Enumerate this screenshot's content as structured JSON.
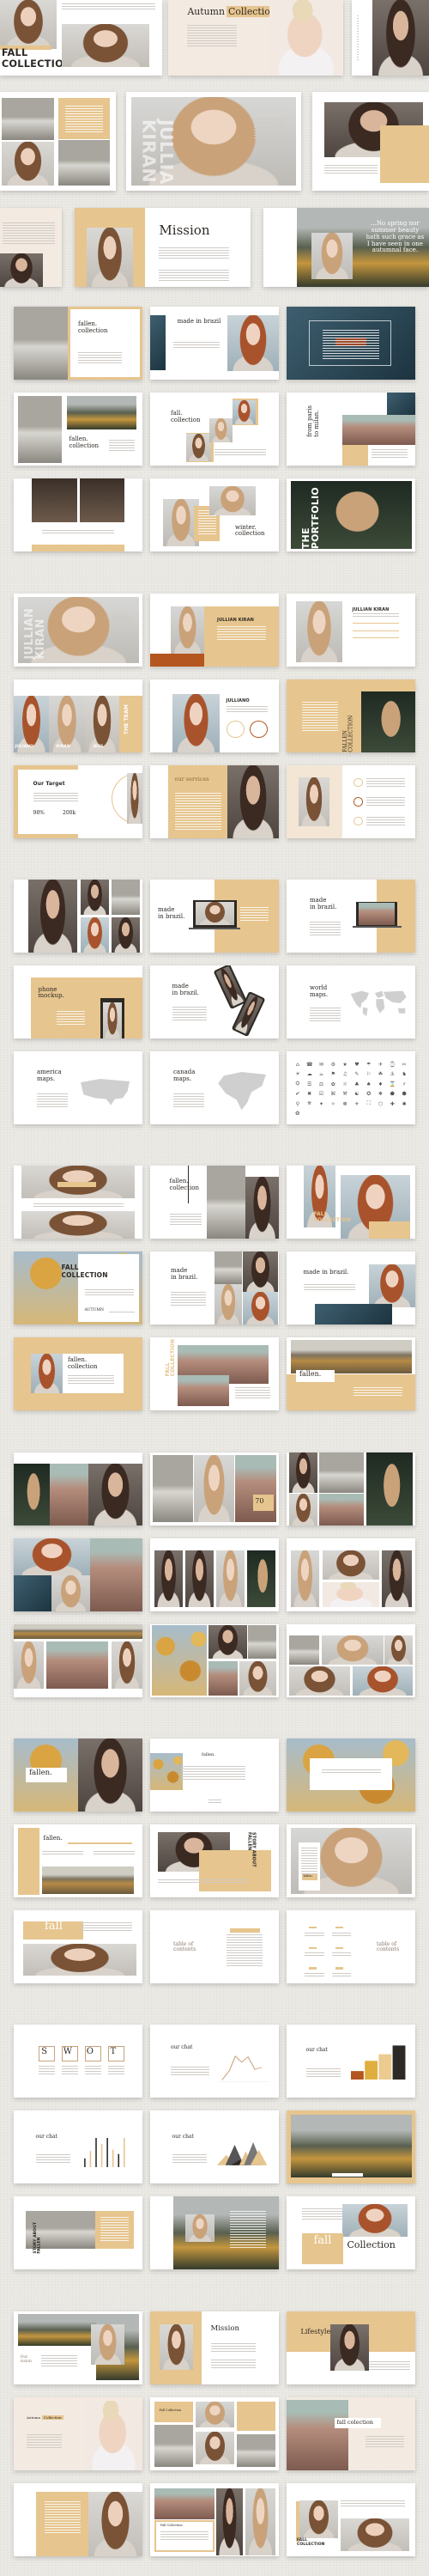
{
  "colors": {
    "page_background": "#ECEAE5",
    "accent_gold": "#E6C58E",
    "rust": "#B4561F",
    "dark": "#2D2925",
    "cream": "#F3EAE1"
  },
  "hero": [
    {
      "layout": "h1",
      "bg": "white",
      "title": "FALL\nCOLLECTION"
    },
    {
      "layout": "h2",
      "bg": "cream",
      "title_a": "Autumn",
      "title_b": "Collection"
    },
    {
      "layout": "h3",
      "bg": "white"
    },
    {
      "layout": "h4",
      "bg": "white"
    },
    {
      "layout": "h5",
      "bg": "white",
      "title": "JULLIAN\nKIRAN"
    },
    {
      "layout": "h6",
      "bg": "white"
    },
    {
      "layout": "h7",
      "bg": "cream"
    },
    {
      "layout": "h8",
      "bg": "white",
      "title": "Mission"
    },
    {
      "layout": "h9",
      "bg": "white",
      "quote": "...No spring nor summer beauty hath such grace as I have seen in one autumnal face."
    }
  ],
  "groups": [
    {
      "slides": [
        {
          "layout": "g1a",
          "bg": "white",
          "title": "fallen.\ncollection"
        },
        {
          "layout": "g1b",
          "bg": "white",
          "title": "made in brazil"
        },
        {
          "layout": "g1c",
          "bg": "white"
        },
        {
          "layout": "g1d",
          "bg": "white",
          "title": "fallen.\ncollection"
        },
        {
          "layout": "g1e",
          "bg": "white",
          "title": "fall.\ncollection"
        },
        {
          "layout": "g1f",
          "bg": "white",
          "title": "from paris\nto milan."
        },
        {
          "layout": "g1g",
          "bg": "white"
        },
        {
          "layout": "g1h",
          "bg": "white",
          "title": "winter.\ncollection"
        },
        {
          "layout": "g1i",
          "bg": "white",
          "title": "THE\nPORTFOLIO"
        }
      ]
    },
    {
      "slides": [
        {
          "layout": "g2a",
          "bg": "white",
          "title": "JULLIAN\nKIRAN"
        },
        {
          "layout": "g2b",
          "bg": "white",
          "title": "JULLIAN KIRAN"
        },
        {
          "layout": "g2c",
          "bg": "white",
          "title": "JULLIAN KIRAN"
        },
        {
          "layout": "g2d",
          "bg": "white",
          "title": "THE TEAM",
          "names": [
            "JULIANO",
            "KIRAN",
            "JESS"
          ]
        },
        {
          "layout": "g2e",
          "bg": "white",
          "title": "JULLIANO"
        },
        {
          "layout": "g2f",
          "bg": "gold",
          "title": "FALLEN COLLECTION"
        },
        {
          "layout": "g2g",
          "bg": "white",
          "title": "Our Target",
          "stat1": "98%",
          "stat2": "200k"
        },
        {
          "layout": "g2h",
          "bg": "white",
          "title": "our services"
        },
        {
          "layout": "g2i",
          "bg": "white"
        }
      ]
    },
    {
      "slides": [
        {
          "layout": "g3a",
          "bg": "white"
        },
        {
          "layout": "g3b",
          "bg": "white",
          "title": "made\nin brazil."
        },
        {
          "layout": "g3c",
          "bg": "white",
          "title": "made\nin brazil."
        },
        {
          "layout": "g3d",
          "bg": "white",
          "title": "phone\nmockup."
        },
        {
          "layout": "g3e",
          "bg": "white",
          "title": "made\nin brazil."
        },
        {
          "layout": "g3f",
          "bg": "white",
          "title": "world\nmaps."
        },
        {
          "layout": "g3g",
          "bg": "white",
          "title": "america\nmaps."
        },
        {
          "layout": "g3h",
          "bg": "white",
          "title": "canada\nmaps."
        },
        {
          "layout": "g3i",
          "bg": "white"
        }
      ]
    },
    {
      "slides": [
        {
          "layout": "g4a",
          "bg": "white"
        },
        {
          "layout": "g4b",
          "bg": "white",
          "title": "fallen.\ncollection"
        },
        {
          "layout": "g4c",
          "bg": "white",
          "title": "FALL\nCOLLECTION"
        },
        {
          "layout": "g4d",
          "bg": "white",
          "title": "FALL\nCOLLECTION",
          "label": "AUTUMN"
        },
        {
          "layout": "g4e",
          "bg": "white",
          "title": "made\nin brazil."
        },
        {
          "layout": "g4f",
          "bg": "white",
          "title": "made in brazil."
        },
        {
          "layout": "g4g",
          "bg": "gold",
          "title": "fallen.\ncollection"
        },
        {
          "layout": "g4h",
          "bg": "white",
          "title": "FALL\nCOLLECTION"
        },
        {
          "layout": "g4i",
          "bg": "white",
          "title": "fallen."
        }
      ]
    },
    {
      "slides": [
        {
          "layout": "g5a",
          "bg": "white"
        },
        {
          "layout": "g5b",
          "bg": "white",
          "badge": "70"
        },
        {
          "layout": "g5c",
          "bg": "white"
        },
        {
          "layout": "g5d",
          "bg": "white"
        },
        {
          "layout": "g5e",
          "bg": "white"
        },
        {
          "layout": "g5f",
          "bg": "white"
        },
        {
          "layout": "g5g",
          "bg": "white"
        },
        {
          "layout": "g5h",
          "bg": "white"
        },
        {
          "layout": "g5i",
          "bg": "white"
        }
      ]
    },
    {
      "slides": [
        {
          "layout": "g6a",
          "bg": "white",
          "title": "fallen."
        },
        {
          "layout": "g6b",
          "bg": "white",
          "title": "fallen."
        },
        {
          "layout": "g6c",
          "bg": "white"
        },
        {
          "layout": "g6d",
          "bg": "white",
          "title": "fallen."
        },
        {
          "layout": "g6e",
          "bg": "white",
          "title": "STORY ABOUT\nFALLEN"
        },
        {
          "layout": "g6f",
          "bg": "white",
          "title": "fallen."
        },
        {
          "layout": "g6g",
          "bg": "white",
          "title": "fall"
        },
        {
          "layout": "g6h",
          "bg": "white",
          "title": "table of\ncontents"
        },
        {
          "layout": "g6i",
          "bg": "white",
          "title": "table of\ncontents"
        }
      ]
    },
    {
      "slides": [
        {
          "layout": "g7a",
          "bg": "white",
          "letters": [
            "S",
            "W",
            "O",
            "T"
          ]
        },
        {
          "layout": "g7b",
          "bg": "white",
          "title": "our chat"
        },
        {
          "layout": "g7c",
          "bg": "white",
          "title": "our chat"
        },
        {
          "layout": "g7d",
          "bg": "white",
          "title": "our chat"
        },
        {
          "layout": "g7e",
          "bg": "white",
          "title": "our chat"
        },
        {
          "layout": "g7f",
          "bg": "gold"
        },
        {
          "layout": "g7g",
          "bg": "white",
          "title": "STORY ABOUT\nFALLEN"
        },
        {
          "layout": "g7h",
          "bg": "white"
        },
        {
          "layout": "g7i",
          "bg": "white",
          "title": "fall",
          "title2": "Collection"
        }
      ]
    },
    {
      "slides": [
        {
          "layout": "g8a",
          "bg": "white",
          "title": "Our\nvision"
        },
        {
          "layout": "g8b",
          "bg": "white",
          "title": "Mission"
        },
        {
          "layout": "g8c",
          "bg": "white",
          "title": "Lifestyle"
        },
        {
          "layout": "g8d",
          "bg": "cream",
          "title_a": "Autumn",
          "title_b": "Collection"
        },
        {
          "layout": "g8e",
          "bg": "white",
          "title": "Fall Collection"
        },
        {
          "layout": "g8f",
          "bg": "cream",
          "title": "fall colection"
        },
        {
          "layout": "g8g",
          "bg": "white"
        },
        {
          "layout": "g8h",
          "bg": "white",
          "title": "Fall Collection"
        },
        {
          "layout": "g8i",
          "bg": "white",
          "title": "FALL\nCOLLECTION"
        }
      ]
    }
  ]
}
